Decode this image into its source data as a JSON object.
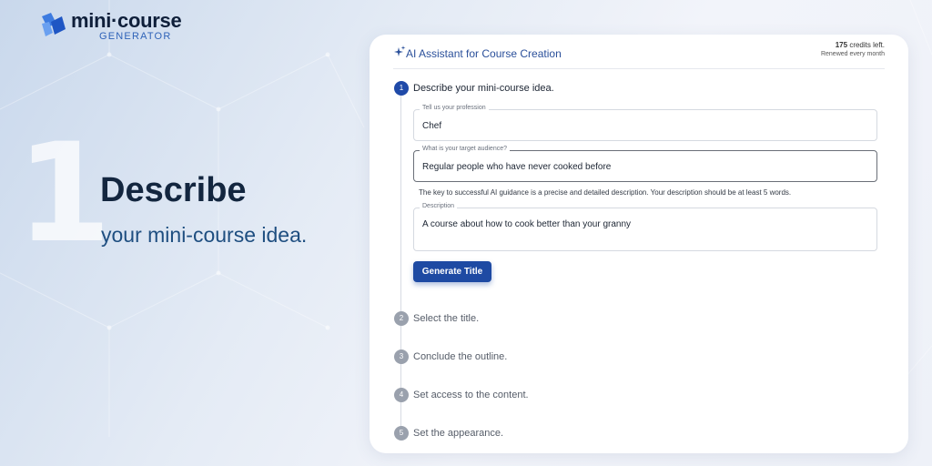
{
  "brand": {
    "name": "mini·course",
    "subtitle": "GENERATOR"
  },
  "hero": {
    "step_number": "1",
    "title": "Describe",
    "subtitle": "your mini-course idea."
  },
  "card": {
    "title": "AI Assistant for Course Creation",
    "credits_count": "175",
    "credits_suffix": " credits left.",
    "credits_renewal": "Renewed every month"
  },
  "steps": [
    {
      "number": "1",
      "label": "Describe your mini-course idea.",
      "active": true
    },
    {
      "number": "2",
      "label": "Select the title.",
      "active": false
    },
    {
      "number": "3",
      "label": "Conclude the outline.",
      "active": false
    },
    {
      "number": "4",
      "label": "Set access to the content.",
      "active": false
    },
    {
      "number": "5",
      "label": "Set the appearance.",
      "active": false
    }
  ],
  "form": {
    "profession": {
      "label": "Tell us your profession",
      "value": "Chef"
    },
    "audience": {
      "label": "What is your target audience?",
      "value": "Regular people who have never cooked before"
    },
    "hint": "The key to successful AI guidance is a precise and detailed description. Your description should be at least 5 words.",
    "description": {
      "label": "Description",
      "value": "A course about how to cook better than your granny"
    },
    "generate_button": "Generate Title"
  },
  "colors": {
    "accent": "#1e4aa3",
    "brand_blue": "#2f63b8",
    "text_dark": "#13263f"
  }
}
